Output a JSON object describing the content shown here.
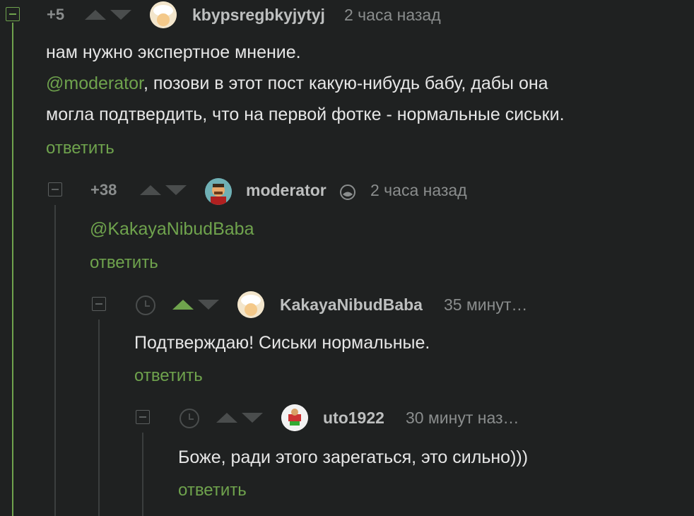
{
  "comments": [
    {
      "rating": "+5",
      "username": "kbypsregbkyjytyj",
      "time": "2 часа назад",
      "line1": "нам нужно экспертное мнение.",
      "mention": "@moderator",
      "line2_rest": ", позови в этот пост какую-нибудь бабу, дабы она",
      "line3": "могла подтвердить, что на первой фотке - нормальные сиськи.",
      "reply_label": "ответить"
    },
    {
      "rating": "+38",
      "username": "moderator",
      "time": "2 часа назад",
      "mention": "@KakayaNibudBaba",
      "reply_label": "ответить"
    },
    {
      "username": "KakayaNibudBaba",
      "time": "35 минут…",
      "text": "Подтверждаю! Сиськи нормальные.",
      "reply_label": "ответить"
    },
    {
      "username": "uto1922",
      "time": "30 минут наз…",
      "text": "Боже, ради этого зарегаться, это сильно)))",
      "reply_label": "ответить"
    }
  ],
  "icons": {
    "collapse": "minus-square-icon",
    "upvote": "triangle-up-icon",
    "downvote": "triangle-down-icon",
    "clock": "clock-icon",
    "moderator_badge": "moon-badge-icon"
  },
  "colors": {
    "background": "#1f2121",
    "accent_green": "#6fa34d",
    "text": "#e6e6e6",
    "muted": "#8a8d8d"
  }
}
